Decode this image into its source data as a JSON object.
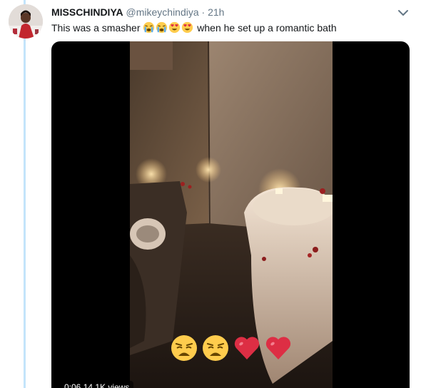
{
  "tweet": {
    "display_name": "MISSCHINDIYA",
    "handle": "@mikeychindiya",
    "separator": "·",
    "time": "21h",
    "text_before": "This was a smasher",
    "text_after": "when he set up a romantic bath",
    "inline_emoji": [
      "loudly-crying-face",
      "loudly-crying-face",
      "heart-eyes-face",
      "heart-eyes-face"
    ]
  },
  "video": {
    "duration": "0:06",
    "views": "14.1K views",
    "overlay_emoji": [
      "weary-face",
      "weary-face",
      "red-heart",
      "red-heart"
    ]
  },
  "colors": {
    "thread_line": "#c4e4fb",
    "handle_gray": "#657786",
    "text_dark": "#14171a"
  }
}
